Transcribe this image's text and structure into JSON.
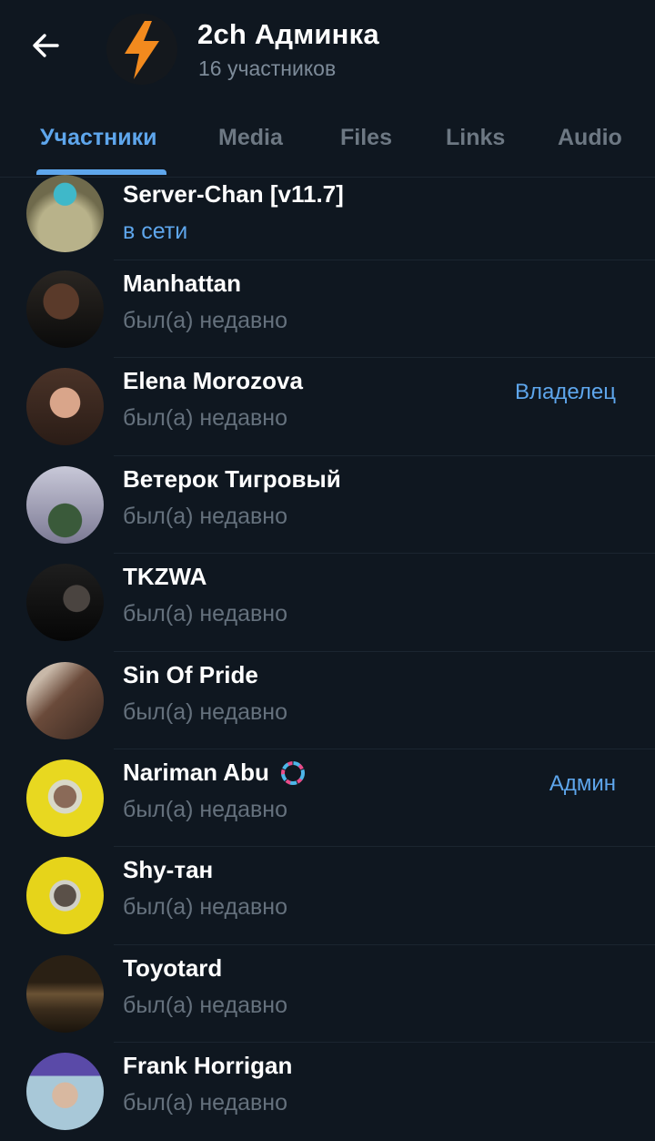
{
  "header": {
    "title": "2ch Админка",
    "subtitle": "16 участников",
    "back_icon": "arrow-left-icon",
    "avatar_icon": "lightning-bolt-icon"
  },
  "tabs": [
    {
      "label": "Участники",
      "active": true
    },
    {
      "label": "Media",
      "active": false
    },
    {
      "label": "Files",
      "active": false
    },
    {
      "label": "Links",
      "active": false
    },
    {
      "label": "Audio",
      "active": false
    }
  ],
  "members": [
    {
      "name": "Server-Chan [v11.7]",
      "status": "в сети",
      "online": true,
      "role": ""
    },
    {
      "name": "Manhattan",
      "status": "был(а) недавно",
      "online": false,
      "role": ""
    },
    {
      "name": "Elena Morozova",
      "status": "был(а) недавно",
      "online": false,
      "role": "Владелец"
    },
    {
      "name": "Ветерок Тигровый",
      "status": "был(а) недавно",
      "online": false,
      "role": ""
    },
    {
      "name": "TKZWA",
      "status": "был(а) недавно",
      "online": false,
      "role": ""
    },
    {
      "name": "Sin Of Pride",
      "status": "был(а) недавно",
      "online": false,
      "role": ""
    },
    {
      "name": "Nariman Abu",
      "status": "был(а) недавно",
      "online": false,
      "role": "Админ"
    },
    {
      "name": "Shy-тан",
      "status": "был(а) недавно",
      "online": false,
      "role": ""
    },
    {
      "name": "Toyotard",
      "status": "был(а) недавно",
      "online": false,
      "role": ""
    },
    {
      "name": "Frank Horrigan",
      "status": "был(а) недавно",
      "online": false,
      "role": ""
    }
  ],
  "colors": {
    "background": "#0f1720",
    "accent": "#5ea6ec",
    "muted": "#65717d",
    "bolt": "#f28a1e"
  }
}
